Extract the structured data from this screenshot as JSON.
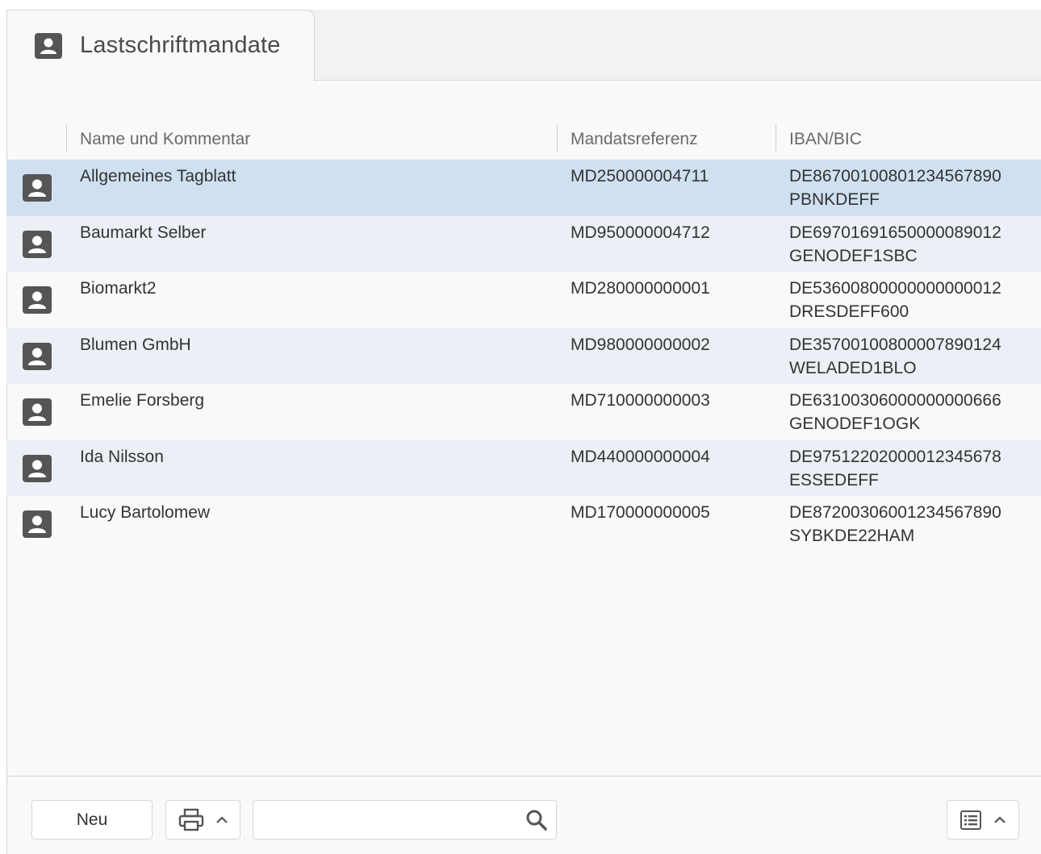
{
  "tab": {
    "title": "Lastschriftmandate",
    "icon": "contact-card-icon"
  },
  "table": {
    "columns": [
      "Name und Kommentar",
      "Mandatsreferenz",
      "IBAN/BIC"
    ],
    "rows": [
      {
        "name": "Allgemeines Tagblatt",
        "ref": "MD250000004711",
        "iban": "DE86700100801234567890",
        "bic": "PBNKDEFF",
        "selected": true
      },
      {
        "name": "Baumarkt Selber",
        "ref": "MD950000004712",
        "iban": "DE69701691650000089012",
        "bic": "GENODEF1SBC"
      },
      {
        "name": "Biomarkt2",
        "ref": "MD280000000001",
        "iban": "DE53600800000000000012",
        "bic": "DRESDEFF600"
      },
      {
        "name": "Blumen GmbH",
        "ref": "MD980000000002",
        "iban": "DE35700100800007890124",
        "bic": "WELADED1BLO"
      },
      {
        "name": "Emelie Forsberg",
        "ref": "MD710000000003",
        "iban": "DE63100306000000000666",
        "bic": "GENODEF1OGK"
      },
      {
        "name": "Ida Nilsson",
        "ref": "MD440000000004",
        "iban": "DE97512202000012345678",
        "bic": "ESSEDEFF"
      },
      {
        "name": "Lucy Bartolomew",
        "ref": "MD170000000005",
        "iban": "DE87200306001234567890",
        "bic": "SYBKDE22HAM"
      }
    ]
  },
  "footer": {
    "new_label": "Neu",
    "print_icon": "printer-icon",
    "search_value": "",
    "search_icon": "search-icon",
    "view_icon": "list-view-icon"
  },
  "colors": {
    "selected_row": "#cfe0f0",
    "alt_row": "#eaf0f5",
    "icon": "#555555"
  }
}
